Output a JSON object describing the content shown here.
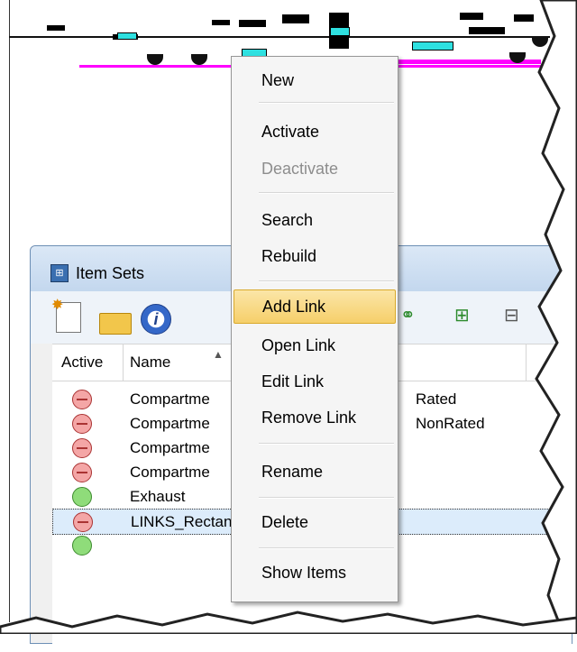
{
  "window": {
    "title": "Item Sets",
    "title_icon": "itemsets-icon"
  },
  "toolbar": {
    "buttons": [
      {
        "name": "new-set-icon"
      },
      {
        "name": "open-folder-icon"
      },
      {
        "name": "info-icon"
      },
      {
        "name": "link-toggle-icon"
      },
      {
        "name": "add-group-icon"
      },
      {
        "name": "remove-group-icon"
      }
    ]
  },
  "table": {
    "columns": [
      "Active",
      "Name"
    ],
    "rows": [
      {
        "status": "inactive",
        "name": "Compartme",
        "suffix": "Rated"
      },
      {
        "status": "inactive",
        "name": "Compartme",
        "suffix": "NonRated"
      },
      {
        "status": "inactive",
        "name": "Compartme",
        "suffix": ""
      },
      {
        "status": "inactive",
        "name": "Compartme",
        "suffix": ""
      },
      {
        "status": "active",
        "name": "Exhaust",
        "suffix": ""
      },
      {
        "status": "inactive",
        "name": "LINKS_Rectangular Fans",
        "suffix": "",
        "selected": true
      }
    ]
  },
  "context_menu": {
    "items": [
      {
        "label": "New",
        "disabled": false
      },
      {
        "label": "Activate",
        "disabled": false
      },
      {
        "label": "Deactivate",
        "disabled": true
      },
      {
        "label": "Search",
        "disabled": false
      },
      {
        "label": "Rebuild",
        "disabled": false
      },
      {
        "label": "Add Link",
        "disabled": false,
        "highlighted": true
      },
      {
        "label": "Open Link",
        "disabled": false
      },
      {
        "label": "Edit Link",
        "disabled": false
      },
      {
        "label": "Remove Link",
        "disabled": false
      },
      {
        "label": "Rename",
        "disabled": false
      },
      {
        "label": "Delete",
        "disabled": false
      },
      {
        "label": "Show Items",
        "disabled": false
      }
    ]
  },
  "colors": {
    "menu_highlight": "#f6cf6a",
    "inactive_status": "#f4a6a6",
    "active_status": "#8fdc7a",
    "cad_cyan": "#2ee0e0",
    "cad_magenta": "#ff00ff"
  }
}
